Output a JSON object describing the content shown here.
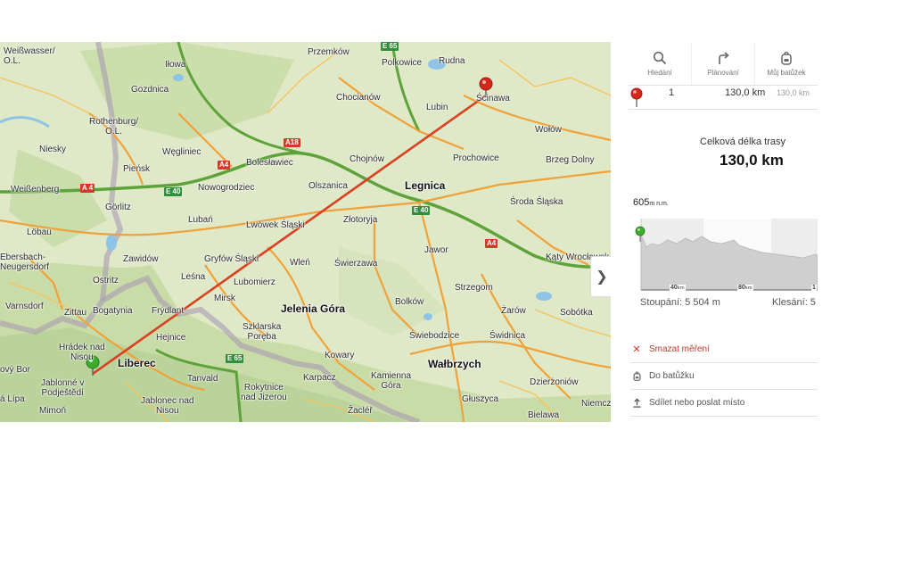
{
  "map": {
    "places": [
      {
        "id": "weisswasser",
        "label": "Weißwasser/\nO.L."
      },
      {
        "id": "ilowa",
        "label": "Iłowa"
      },
      {
        "id": "przemkow",
        "label": "Przemków"
      },
      {
        "id": "polkowice",
        "label": "Polkowice"
      },
      {
        "id": "rudna",
        "label": "Rudna"
      },
      {
        "id": "gozdnica",
        "label": "Gozdnica"
      },
      {
        "id": "chocianow",
        "label": "Chocianów"
      },
      {
        "id": "scinawa",
        "label": "Ścinawa"
      },
      {
        "id": "rothenburg",
        "label": "Rothenburg/\nO.L."
      },
      {
        "id": "lubin",
        "label": "Lubin"
      },
      {
        "id": "wolow",
        "label": "Wołów"
      },
      {
        "id": "niesky",
        "label": "Niesky"
      },
      {
        "id": "wegliniec",
        "label": "Węgliniec"
      },
      {
        "id": "boleslawiec",
        "label": "Bolesławiec"
      },
      {
        "id": "chojnow",
        "label": "Chojnów"
      },
      {
        "id": "prochowice",
        "label": "Prochowice"
      },
      {
        "id": "brzeg",
        "label": "Brzeg Dolny"
      },
      {
        "id": "piensk",
        "label": "Pieńsk"
      },
      {
        "id": "weissenberg",
        "label": "Weißenberg"
      },
      {
        "id": "nowogrodziec",
        "label": "Nowogrodziec"
      },
      {
        "id": "olszanica",
        "label": "Olszanica"
      },
      {
        "id": "legnica",
        "label": "Legnica"
      },
      {
        "id": "gorlitz",
        "label": "Görlitz"
      },
      {
        "id": "sroda",
        "label": "Środa Śląska"
      },
      {
        "id": "luban",
        "label": "Lubań"
      },
      {
        "id": "lwowek",
        "label": "Lwówek Śląski"
      },
      {
        "id": "zlotoryja",
        "label": "Złotoryja"
      },
      {
        "id": "lobau",
        "label": "Löbau"
      },
      {
        "id": "jawor",
        "label": "Jawor"
      },
      {
        "id": "ebersbach",
        "label": "Ebersbach-\nNeugersdorf"
      },
      {
        "id": "zawidow",
        "label": "Zawidów"
      },
      {
        "id": "gryfow",
        "label": "Gryfów Śląski"
      },
      {
        "id": "wlen",
        "label": "Wleń"
      },
      {
        "id": "swierzawa",
        "label": "Świerzawa"
      },
      {
        "id": "katy",
        "label": "Kąty Wrocławsk"
      },
      {
        "id": "lesna",
        "label": "Leśna"
      },
      {
        "id": "ostritz",
        "label": "Ostritz"
      },
      {
        "id": "lubomierz",
        "label": "Lubomierz"
      },
      {
        "id": "strzegom",
        "label": "Strzegom"
      },
      {
        "id": "varnsdorf",
        "label": "Varnsdorf"
      },
      {
        "id": "mirsk",
        "label": "Mirsk"
      },
      {
        "id": "bolkow",
        "label": "Bolków"
      },
      {
        "id": "zittau",
        "label": "Zittau"
      },
      {
        "id": "bogatynia",
        "label": "Bogatynia"
      },
      {
        "id": "frydlant",
        "label": "Frýdlant"
      },
      {
        "id": "jelenia",
        "label": "Jelenia Góra"
      },
      {
        "id": "zarow",
        "label": "Żarów"
      },
      {
        "id": "sobotka",
        "label": "Sobótka"
      },
      {
        "id": "szklarska",
        "label": "Szklarska\nPoręba"
      },
      {
        "id": "hejnice",
        "label": "Hejnice"
      },
      {
        "id": "swiebodzice",
        "label": "Świebodzice"
      },
      {
        "id": "swidnica",
        "label": "Świdnica"
      },
      {
        "id": "hradek",
        "label": "Hrádek nad\nNisou"
      },
      {
        "id": "kowary",
        "label": "Kowary"
      },
      {
        "id": "liberec",
        "label": "Liberec"
      },
      {
        "id": "walbrzych",
        "label": "Wałbrzych"
      },
      {
        "id": "novybor",
        "label": "ový Bor"
      },
      {
        "id": "tanvald",
        "label": "Tanvald"
      },
      {
        "id": "karpacz",
        "label": "Karpacz"
      },
      {
        "id": "kamienna",
        "label": "Kamienna\nGóra"
      },
      {
        "id": "dzierzoniow",
        "label": "Dzierżoniów"
      },
      {
        "id": "jablonne",
        "label": "Jablonné v\nPodještědí"
      },
      {
        "id": "rokytnice",
        "label": "Rokytnice\nnad Jizerou"
      },
      {
        "id": "lipa",
        "label": "á Lípa"
      },
      {
        "id": "jablonec",
        "label": "Jablonec nad\nNisou"
      },
      {
        "id": "gluszyca",
        "label": "Głuszyca"
      },
      {
        "id": "niemcz",
        "label": "Niemcz"
      },
      {
        "id": "mimon",
        "label": "Mimoň"
      },
      {
        "id": "zacler",
        "label": "Žacléř"
      },
      {
        "id": "bielawa",
        "label": "Bielawa"
      }
    ],
    "shields": [
      {
        "id": "e65top",
        "label": "E 65"
      },
      {
        "id": "a18",
        "label": "A18"
      },
      {
        "id": "a4w",
        "label": "A 4"
      },
      {
        "id": "a4c",
        "label": "A4"
      },
      {
        "id": "e40w",
        "label": "E 40"
      },
      {
        "id": "e40e",
        "label": "E 40"
      },
      {
        "id": "a4e",
        "label": "A4"
      },
      {
        "id": "e65b",
        "label": "E 65"
      }
    ],
    "toggle_icon": "chevron-right-icon",
    "toggle_glyph": "❯",
    "route_color": "#d9401f",
    "start_marker_color": "#3cab2e",
    "end_marker_color": "#d6271c"
  },
  "panel": {
    "toolbar": [
      {
        "id": "search",
        "label": "Hledání",
        "icon": "magnifier-icon"
      },
      {
        "id": "plan",
        "label": "Plánování",
        "icon": "route-turn-icon"
      },
      {
        "id": "bag",
        "label": "Můj batůžek",
        "icon": "backpack-icon"
      }
    ],
    "route_row": {
      "index": "1",
      "distance": "130,0 km",
      "cumulative": "130,0 km",
      "icon": "red-pin-icon"
    },
    "total": {
      "label": "Celková délka trasy",
      "value": "130,0 km"
    },
    "profile": {
      "max_alt": "605",
      "unit": "m n.m.",
      "axis": [
        "40",
        "80",
        "1"
      ],
      "axis_unit": "km",
      "ascent": "Stoupání: 5 504 m",
      "descent": "Klesání: 5"
    },
    "actions": {
      "delete": {
        "label": "Smazat měření",
        "icon": "close-x-icon",
        "glyph": "✕"
      },
      "bag": {
        "label": "Do batůžku",
        "icon": "backpack-icon"
      },
      "share": {
        "label": "Sdílet nebo poslat místo",
        "icon": "share-arrow-icon"
      }
    }
  }
}
